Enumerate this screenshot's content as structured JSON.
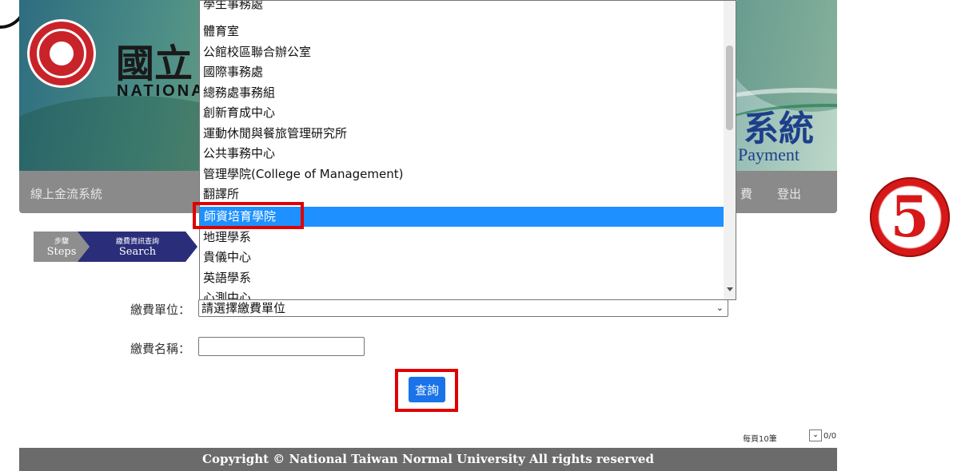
{
  "banner": {
    "school_cjk": "國立",
    "school_en": "NATIONAL",
    "system_title_cjk": "系統",
    "system_subtitle": "Payment"
  },
  "nav": {
    "left_label": "線上金流系統",
    "right_label_partial": "費",
    "logout": "登出"
  },
  "steps": [
    {
      "top": "步驟",
      "bottom": "Steps"
    },
    {
      "top": "繳費資訊查詢",
      "bottom": "Search"
    }
  ],
  "form": {
    "unit_label": "繳費單位：",
    "unit_selected": "請選擇繳費單位",
    "name_label": "繳費名稱：",
    "name_value": "",
    "query_button": "查詢"
  },
  "dropdown": {
    "options": [
      "學生事務處",
      "體育室",
      "公館校區聯合辦公室",
      "國際事務處",
      "總務處事務組",
      "創新育成中心",
      "運動休閒與餐旅管理研究所",
      "公共事務中心",
      "管理學院(College of Management)",
      "翻譯所",
      "師資培育學院",
      "地理學系",
      "貴儀中心",
      "英語學系",
      "心測中心"
    ],
    "highlighted": "師資培育學院"
  },
  "annotation": {
    "step_number": "5"
  },
  "paging": {
    "per_page": "每頁10筆",
    "count": "0/0"
  },
  "footer": {
    "copyright": "Copyright © National Taiwan Normal University All rights reserved"
  },
  "colors": {
    "nav_bg": "#8a8a8a",
    "highlight": "#1e90ff",
    "query_button": "#1a73e8",
    "annotation_red": "#e00000",
    "footer_bg": "#6b6b6b"
  }
}
